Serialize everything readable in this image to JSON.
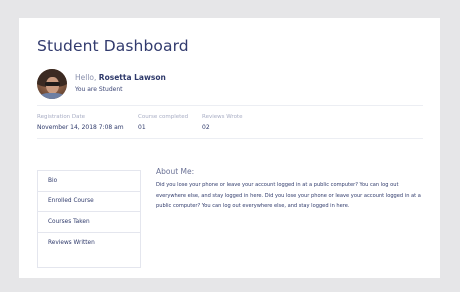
{
  "page": {
    "title": "Student Dashboard"
  },
  "profile": {
    "greeting": "Hello,",
    "name": "Rosetta Lawson",
    "role": "You are Student"
  },
  "stats": [
    {
      "label": "Registration Date",
      "value": "November 14, 2018 7:08 am"
    },
    {
      "label": "Course completed",
      "value": "01"
    },
    {
      "label": "Reviews Wrote",
      "value": "02"
    }
  ],
  "menu": {
    "items": [
      {
        "label": "Bio"
      },
      {
        "label": "Enrolled Course"
      },
      {
        "label": "Courses Taken"
      },
      {
        "label": "Reviews Written"
      }
    ]
  },
  "about": {
    "title": "About Me:",
    "text": "Did you lose your phone or leave your account logged in at a public computer? You can log out everywhere else, and stay logged in here. Did you lose your phone or leave your account logged in at a public computer? You can log out everywhere else, and stay logged in here."
  },
  "colors": {
    "background": "#e6e6e8",
    "card": "#ffffff",
    "text_primary": "#2f3a6b",
    "text_muted": "#a8adc4"
  }
}
